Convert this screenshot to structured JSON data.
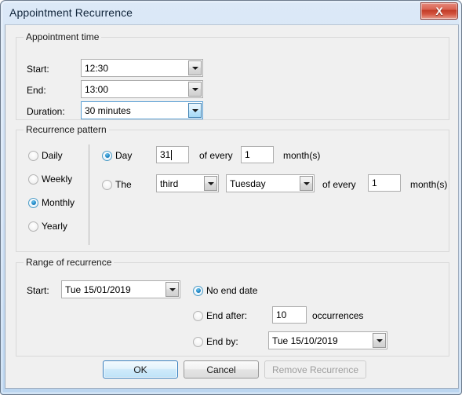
{
  "window": {
    "title": "Appointment Recurrence",
    "close_icon": "close-icon",
    "close_label": "X"
  },
  "appointment_time": {
    "legend": "Appointment time",
    "start_label": "Start:",
    "start_value": "12:30",
    "end_label": "End:",
    "end_value": "13:00",
    "duration_label": "Duration:",
    "duration_value": "30 minutes"
  },
  "recurrence_pattern": {
    "legend": "Recurrence pattern",
    "frequency": [
      {
        "label": "Daily",
        "selected": false
      },
      {
        "label": "Weekly",
        "selected": false
      },
      {
        "label": "Monthly",
        "selected": true
      },
      {
        "label": "Yearly",
        "selected": false
      }
    ],
    "day_radio_label": "Day",
    "day_radio_selected": true,
    "day_value": "31",
    "day_of_every_label": "of every",
    "day_interval_value": "1",
    "day_months_label": "month(s)",
    "the_radio_label": "The",
    "the_radio_selected": false,
    "ordinal_value": "third",
    "weekday_value": "Tuesday",
    "the_of_every_label": "of every",
    "the_interval_value": "1",
    "the_months_label": "month(s)"
  },
  "range_of_recurrence": {
    "legend": "Range of recurrence",
    "start_label": "Start:",
    "start_value": "Tue 15/01/2019",
    "no_end_date_label": "No end date",
    "no_end_date_selected": true,
    "end_after_label": "End after:",
    "end_after_selected": false,
    "occurrences_value": "10",
    "occurrences_label": "occurrences",
    "end_by_label": "End by:",
    "end_by_selected": false,
    "end_by_value": "Tue 15/10/2019"
  },
  "footer": {
    "ok_label": "OK",
    "cancel_label": "Cancel",
    "remove_recurrence_label": "Remove Recurrence"
  },
  "colors": {
    "accent": "#2089c8",
    "close_button": "#c13a26",
    "dialog_background": "#f0f0f0",
    "default_button_border": "#2f7bbd"
  }
}
